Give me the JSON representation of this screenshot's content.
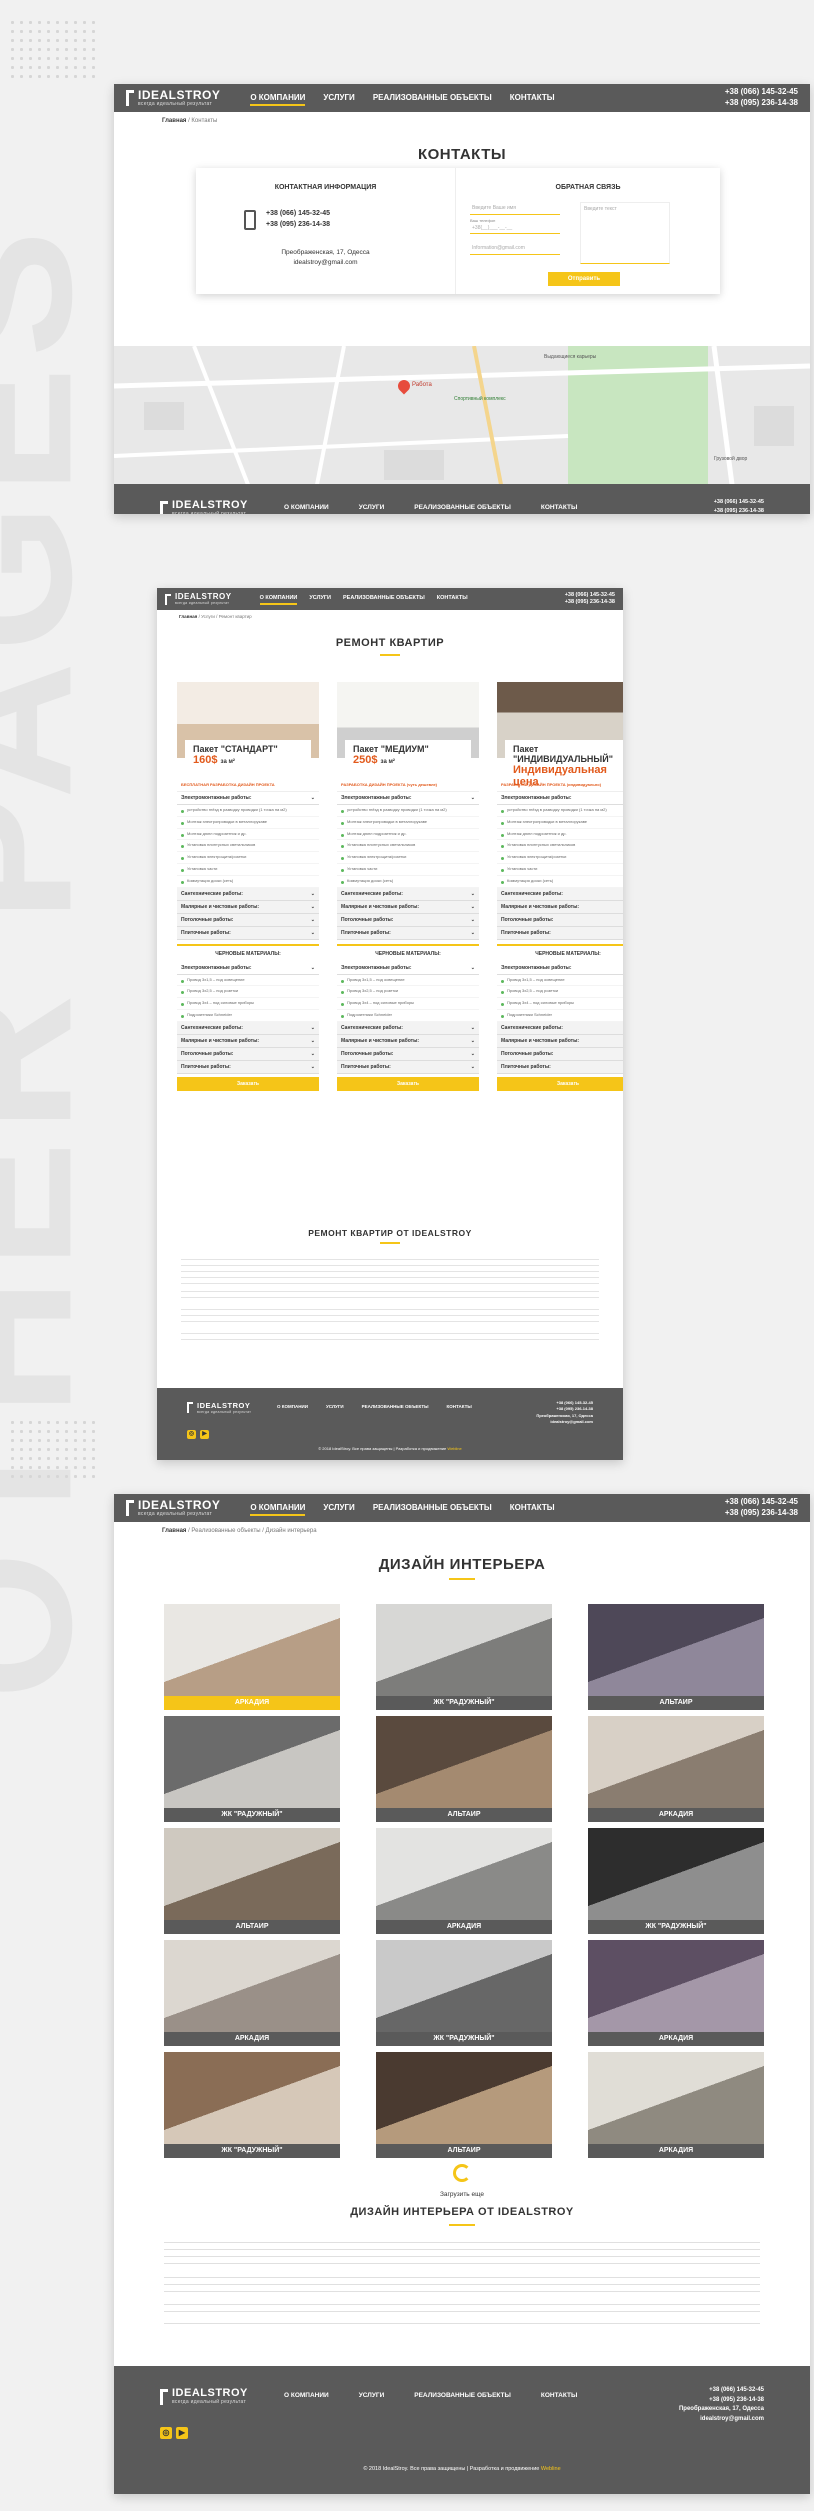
{
  "background_word": "OTHER PAGES",
  "colors": {
    "accent": "#f5c518",
    "header": "#5a5a5a",
    "price": "#e25a1c",
    "check": "#5cb85c"
  },
  "brand": {
    "name": "IDEALSTROY",
    "tagline": "всегда идеальный результат"
  },
  "nav": {
    "about": "О КОМПАНИИ",
    "services": "УСЛУГИ",
    "projects": "РЕАЛИЗОВАННЫЕ ОБЪЕКТЫ",
    "contacts": "КОНТАКТЫ"
  },
  "phones": {
    "p1": "+38 (066) 145-32-45",
    "p2": "+38 (095) 236-14-38"
  },
  "footer": {
    "address": "Преображенская, 17, Одесса",
    "email": "idealstroy@gmail.com",
    "copyright": "© 2018 IdealStroy. Все права защищены | Разработка и продвижение",
    "studio": "Webline"
  },
  "contacts_page": {
    "breadcrumb_home": "Главная",
    "breadcrumb_current": "Контакты",
    "title": "КОНТАКТЫ",
    "info_title": "КОНТАКТНАЯ ИНФОРМАЦИЯ",
    "phone1": "+38 (066) 145-32-45",
    "phone2": "+38 (095) 236-14-38",
    "address": "Преображенская, 17, Одесса",
    "email": "idealstroy@gmail.com",
    "form_title": "ОБРАТНАЯ СВЯЗЬ",
    "ph_name": "Введите Ваше имя",
    "ph_phone": "+38(__)___-__-__",
    "phone_label": "Ваш телефон",
    "ph_email": "Information@gmail.com",
    "ph_text": "Введите текст",
    "submit": "Отправить",
    "map_label_1": "Работа",
    "map_label_2": "Выдающиеся карьеры",
    "map_label_3": "Спортивный комплекс",
    "map_label_4": "Грузовой двор"
  },
  "renovation_page": {
    "breadcrumb_home": "Главная",
    "breadcrumb_mid": "Услуги",
    "breadcrumb_current": "Ремонт квартир",
    "title": "РЕМОНТ КВАРТИР",
    "packages": [
      {
        "name": "Пакет \"СТАНДАРТ\"",
        "price": "160$",
        "unit": "за м²",
        "note": "БЕСПЛАТНАЯ РАЗРАБОТКА ДИЗАЙН ПРОЕКТА",
        "button": "Заказать"
      },
      {
        "name": "Пакет \"МЕДИУМ\"",
        "price": "250$",
        "unit": "за м²",
        "note": "РАЗРАБОТКА ДИЗАЙН ПРОЕКТА (чуть дешевле)",
        "button": "Заказать"
      },
      {
        "name": "Пакет \"ИНДИВИДУАЛЬНЫЙ\"",
        "price": "Индивидуальная цена",
        "unit": "",
        "note": "РАЗРАБОТКА ДИЗАЙН ПРОЕКТА (индивидуально)",
        "button": "Заказать"
      }
    ],
    "sections": {
      "electric": "Электромонтажные работы:",
      "plumbing": "Сантехнические работы:",
      "paint": "Малярные и чистовые работы:",
      "ceiling": "Потолочные работы:",
      "tile": "Плиточные работы:",
      "rough": "ЧЕРНОВЫЕ МАТЕРИАЛЫ:"
    },
    "electric_items": [
      "устройство гнёзд в разводку проводки (1 точка на м2)",
      "Монтаж электропроводки в металлорукаве",
      "Монтаж дюпл подрозетник и др.",
      "Установка плинтусных светильников",
      "Установка электрощита/розетки",
      "Установка части",
      "Коммутация доски (сеть)"
    ],
    "rough_items": [
      "Провод 3х1,5 – под освещение",
      "Провод 3х2,5 – под розетки",
      "Провод 3х4 – под силовые приборы",
      "Подрозетники Schneider"
    ],
    "section_title": "РЕМОНТ КВАРТИР ОТ IDEALSTROY"
  },
  "design_page": {
    "breadcrumb_home": "Главная",
    "breadcrumb_mid": "Реализованные объекты",
    "breadcrumb_current": "Дизайн интерьера",
    "title": "ДИЗАЙН ИНТЕРЬЕРА",
    "tiles": [
      "АРКАДИЯ",
      "ЖК \"РАДУЖНЫЙ\"",
      "АЛЬТАИР",
      "ЖК \"РАДУЖНЫЙ\"",
      "АЛЬТАИР",
      "АРКАДИЯ",
      "АЛЬТАИР",
      "АРКАДИЯ",
      "ЖК \"РАДУЖНЫЙ\"",
      "АРКАДИЯ",
      "ЖК \"РАДУЖНЫЙ\"",
      "АРКАДИЯ",
      "ЖК \"РАДУЖНЫЙ\"",
      "АЛЬТАИР",
      "АРКАДИЯ"
    ],
    "load_more": "Загрузить еще",
    "section_title": "ДИЗАЙН ИНТЕРЬЕРА ОТ IDEALSTROY"
  }
}
